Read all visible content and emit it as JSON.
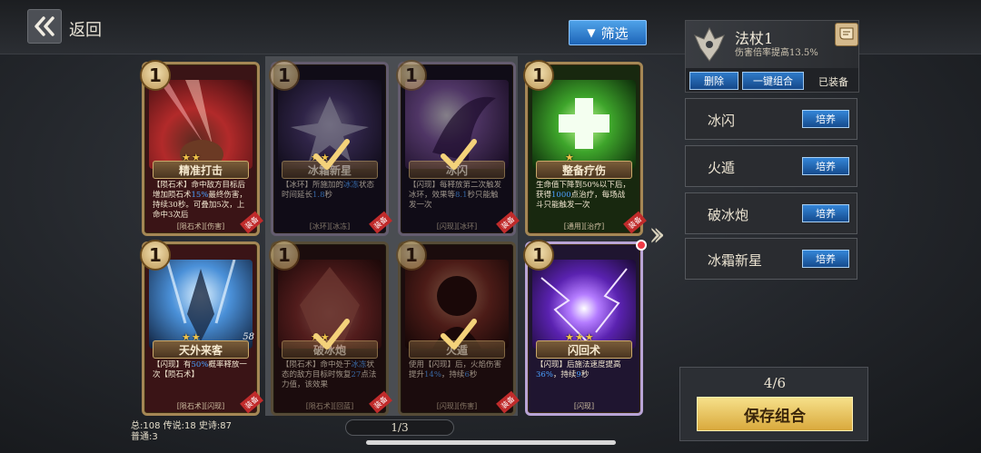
{
  "header": {
    "back_label": "返回",
    "filter_label": "筛选"
  },
  "cards": [
    {
      "cost": "1",
      "name": "精准打击",
      "desc_parts": [
        "【陨石术】命中敌方目标后增加陨石术",
        "15%",
        "最终伤害，持续30秒。可叠加5次，上命中3次后"
      ],
      "tags": "[陨石术][伤害]",
      "stars": "★★",
      "equipped": "装备"
    },
    {
      "cost": "1",
      "name": "冰霜新星",
      "desc_parts": [
        "【冰环】所施加的",
        "冰冻",
        "状态时间延长",
        "1.8",
        "秒"
      ],
      "tags": "[冰环][冰冻]",
      "stars": "★★",
      "equipped": "装备"
    },
    {
      "cost": "1",
      "name": "冰闪",
      "desc_parts": [
        "【闪现】每释放第二次触发冰环，效果等",
        "8.1",
        "秒只能触发一次"
      ],
      "tags": "[闪现][冰环]",
      "stars": "",
      "equipped": "装备"
    },
    {
      "cost": "1",
      "name": "整备疗伤",
      "desc_parts": [
        "生命值下降到50%以下后，获得",
        "1000",
        "点治疗，每场战斗只能触发一次"
      ],
      "tags": "[通用][治疗]",
      "stars": "★",
      "equipped": "装备"
    },
    {
      "cost": "1",
      "name": "天外来客",
      "desc_parts": [
        "【闪现】有",
        "50%",
        "概率释放一次【陨石术】"
      ],
      "tags": "[陨石术][闪现]",
      "stars": "★★",
      "extra": "58",
      "equipped": "装备"
    },
    {
      "cost": "1",
      "name": "破冰炮",
      "desc_parts": [
        "【陨石术】命中处于",
        "冰冻",
        "状态的敌方目标时恢复",
        "27",
        "点法力值，该效果"
      ],
      "tags": "[陨石术][回蓝]",
      "stars": "★★",
      "equipped": "装备"
    },
    {
      "cost": "1",
      "name": "火遁",
      "desc_parts": [
        "使用【闪现】后，火焰伤害提升",
        "14%",
        "，持续",
        "6",
        "秒"
      ],
      "tags": "[闪现][伤害]",
      "stars": "",
      "equipped": "装备"
    },
    {
      "cost": "1",
      "name": "闪回术",
      "desc_parts": [
        "【闪现】后施法速度提高",
        "36%",
        "，持续",
        "9",
        "秒"
      ],
      "tags": "[闪现]",
      "stars": "★★★",
      "equipped": ""
    }
  ],
  "staff": {
    "name": "法杖1",
    "subtitle": "伤害倍率提高13.5%",
    "delete_label": "删除",
    "auto_label": "一键组合",
    "equipped_label": "已装备"
  },
  "combo": [
    {
      "name": "冰闪",
      "train": "培养"
    },
    {
      "name": "火遁",
      "train": "培养"
    },
    {
      "name": "破冰炮",
      "train": "培养"
    },
    {
      "name": "冰霜新星",
      "train": "培养"
    }
  ],
  "save": {
    "count": "4/6",
    "label": "保存组合"
  },
  "stats": {
    "line1": "总:108 传说:18 史诗:87",
    "line2": "普通:3"
  },
  "page": {
    "indicator": "1/3"
  },
  "colors": {
    "accent_blue": "#2f7bc9",
    "gold": "#d9a93c",
    "highlight": "#4ba0ff"
  }
}
